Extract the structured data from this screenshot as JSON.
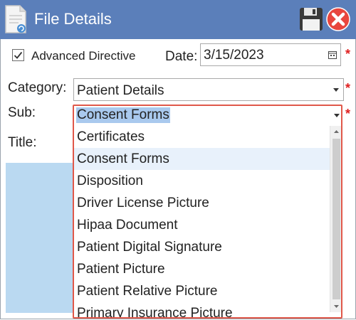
{
  "window": {
    "title": "File Details"
  },
  "colors": {
    "titlebar": "#5b7fba",
    "required": "#e02020",
    "highlight_border": "#e0584a",
    "selection": "#a9c9ee"
  },
  "icons": [
    "document-icon",
    "save-icon",
    "close-icon",
    "calendar-icon",
    "chevron-down-icon"
  ],
  "form": {
    "advanced_directive": {
      "label": "Advanced Directive",
      "checked": true
    },
    "date": {
      "label": "Date:",
      "value": "3/15/2023"
    },
    "category": {
      "label": "Category:",
      "value": "Patient Details"
    },
    "sub": {
      "label": "Sub:",
      "value": "Consent Forms"
    },
    "title": {
      "label": "Title:"
    },
    "required_marker": "*"
  },
  "sub_dropdown": {
    "items": [
      "Certificates",
      "Consent Forms",
      "Disposition",
      "Driver License Picture",
      "Hipaa Document",
      "Patient Digital Signature",
      "Patient Picture",
      "Patient Relative Picture",
      "Primary Insurance Picture"
    ],
    "selected": "Consent Forms"
  }
}
